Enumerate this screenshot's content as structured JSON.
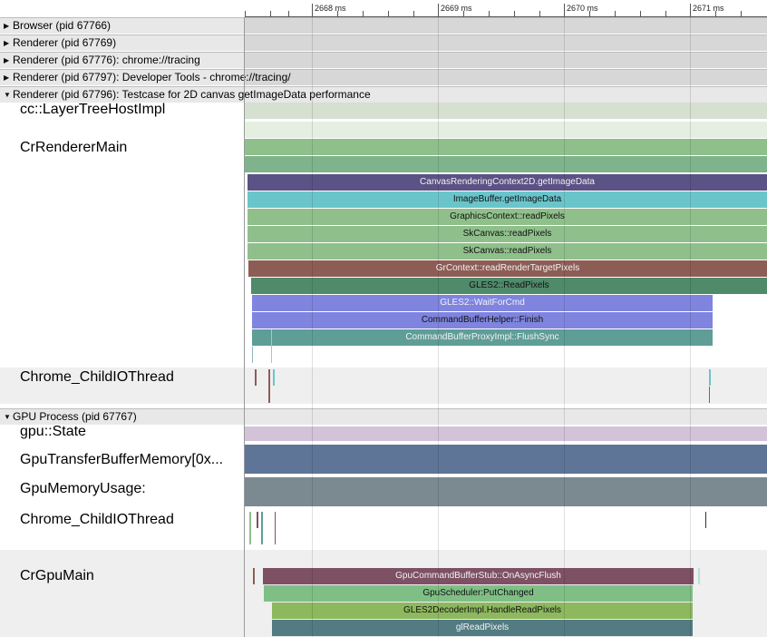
{
  "ruler": {
    "labels": [
      "2668 ms",
      "2669 ms",
      "2670 ms",
      "2671 ms"
    ]
  },
  "processes": {
    "browser": "Browser (pid 67766)",
    "renderer1": "Renderer (pid 67769)",
    "renderer2": "Renderer (pid 67776): chrome://tracing",
    "renderer3": "Renderer (pid 67797): Developer Tools - chrome://tracing/",
    "renderer4": "Renderer (pid 67796): Testcase for 2D canvas getImageData performance",
    "gpu": "GPU Process (pid 67767)"
  },
  "threads": {
    "layer_tree": "cc::LayerTreeHostImpl",
    "renderer_main": "CrRendererMain",
    "child_io_renderer": "Chrome_ChildIOThread",
    "gpu_state": "gpu::State",
    "transfer_buffer": "GpuTransferBufferMemory[0x...",
    "memory_usage": "GpuMemoryUsage:",
    "child_io_gpu": "Chrome_ChildIOThread",
    "gpu_main": "CrGpuMain"
  },
  "slices": {
    "s1": "CanvasRenderingContext2D.getImageData",
    "s2": "ImageBuffer.getImageData",
    "s3": "GraphicsContext::readPixels",
    "s4": "SkCanvas::readPixels",
    "s5": "SkCanvas::readPixels",
    "s6": "GrContext::readRenderTargetPixels",
    "s7": "GLES2::ReadPixels",
    "s8": "GLES2::WaitForCmd",
    "s9": "CommandBufferHelper::Finish",
    "s10": "CommandBufferProxyImpl::FlushSync",
    "g1": "GpuCommandBufferStub::OnAsyncFlush",
    "g2": "GpuScheduler:PutChanged",
    "g3": "GLES2DecoderImpl.HandleReadPixels",
    "g4": "glReadPixels"
  },
  "colors": {
    "slice_purple": "#5b5285",
    "slice_cyan": "#6ac5cb",
    "slice_green": "#8fc08b",
    "slice_brown": "#8d5d55",
    "slice_darkgreen": "#4f8a6a",
    "slice_blue": "#7f84df",
    "slice_teal": "#5f9e97",
    "gpu_maroon": "#7d5064",
    "gpu_lightgreen": "#7fbf85",
    "gpu_olive": "#8db85d",
    "gpu_steel": "#527b82"
  }
}
